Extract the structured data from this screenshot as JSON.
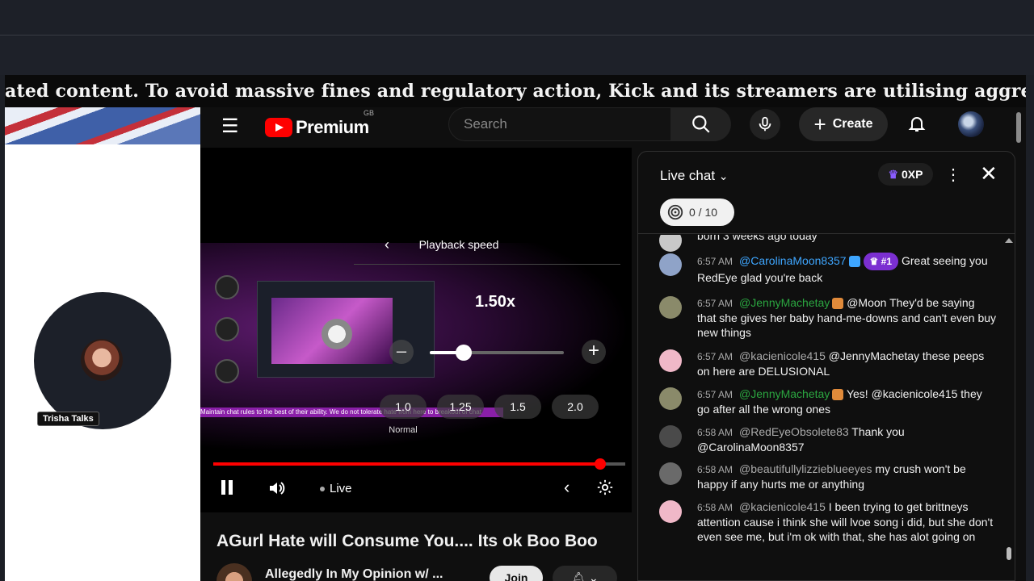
{
  "ticker": {
    "text": "ated content. To avoid massive fines and regulatory action, Kick and its streamers are utilising aggressive AI mo"
  },
  "host": {
    "label": "Trisha Talks"
  },
  "youtube": {
    "logo_text": "Premium",
    "logo_region": "GB",
    "search_placeholder": "Search",
    "create_label": "Create"
  },
  "player": {
    "speed_title": "Playback speed",
    "speed_value": "1.50x",
    "speed_fraction": 0.25,
    "minus": "–",
    "plus": "+",
    "presets": [
      "1.0",
      "1.25",
      "1.5",
      "2.0"
    ],
    "preset_note": "Normal",
    "progress": 0.94,
    "live_label": "Live",
    "inner_marquee": "Maintain chat rules to the best of their ability. We do not tolerate hate from here to breakout of chat"
  },
  "video": {
    "title": "AGurl Hate will Consume You.... Its ok Boo Boo",
    "channel": "Allegedly In My Opinion w/ ...",
    "join_label": "Join"
  },
  "chat": {
    "title": "Live chat",
    "xp": "0XP",
    "goal": "0 / 10",
    "messages": [
      {
        "time": "",
        "author": "",
        "text": "born 3 weeks ago today",
        "color": "#c8c8c8"
      },
      {
        "time": "6:57 AM",
        "author": "@CarolinaMoon8357",
        "rank": "#1",
        "text": "Great seeing you RedEye glad you're back",
        "color": "#8fa3c8",
        "author_class": "auth-blue"
      },
      {
        "time": "6:57 AM",
        "author": "@JennyMachetay",
        "text": "@Moon They'd be saying that she gives her baby hand-me-downs and can't even buy new things",
        "color": "#8a8a6a",
        "author_class": "auth-green"
      },
      {
        "time": "6:57 AM",
        "author": "@kacienicole415",
        "text": "@JennyMachetay these peeps on here are DELUSIONAL",
        "color": "#f0b8c8",
        "author_class": "auth-grey"
      },
      {
        "time": "6:57 AM",
        "author": "@JennyMachetay",
        "text": "Yes! @kacienicole415 they go after all the wrong ones",
        "color": "#8a8a6a",
        "author_class": "auth-green"
      },
      {
        "time": "6:58 AM",
        "author": "@RedEyeObsolete83",
        "text": "Thank you @CarolinaMoon8357",
        "color": "#4a4a4a",
        "author_class": "auth-grey"
      },
      {
        "time": "6:58 AM",
        "author": "@beautifullylizzieblueeyes",
        "text": "my crush won't be happy if any hurts me or anything",
        "color": "#6a6a6a",
        "author_class": "auth-grey"
      },
      {
        "time": "6:58 AM",
        "author": "@kacienicole415",
        "text": "I been trying to get brittneys attention cause i think she will lvoe song i did, but she don't even see me, but i'm ok with that, she has alot going on",
        "color": "#f0b8c8",
        "author_class": "auth-grey"
      }
    ]
  }
}
